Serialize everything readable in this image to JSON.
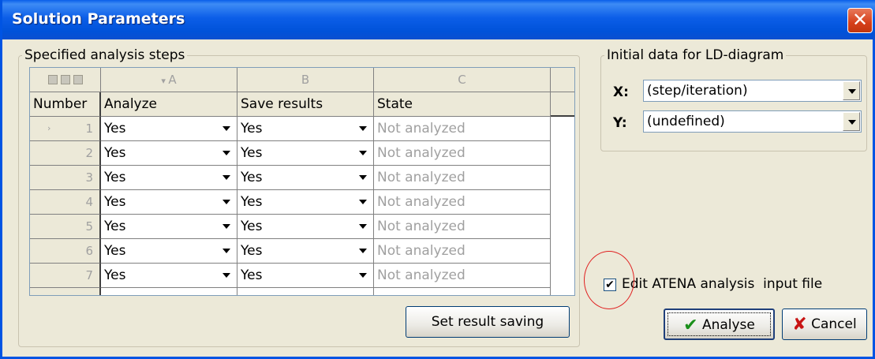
{
  "window": {
    "title": "Solution Parameters",
    "close_glyph": "✕"
  },
  "steps_group": {
    "legend": "Specified analysis steps"
  },
  "grid": {
    "column_letters": [
      "A",
      "B",
      "C"
    ],
    "column_names": [
      "Number",
      "Analyze",
      "Save results",
      "State"
    ],
    "rows": [
      {
        "number": "1",
        "analyze": "Yes",
        "save": "Yes",
        "state": "Not analyzed"
      },
      {
        "number": "2",
        "analyze": "Yes",
        "save": "Yes",
        "state": "Not analyzed"
      },
      {
        "number": "3",
        "analyze": "Yes",
        "save": "Yes",
        "state": "Not analyzed"
      },
      {
        "number": "4",
        "analyze": "Yes",
        "save": "Yes",
        "state": "Not analyzed"
      },
      {
        "number": "5",
        "analyze": "Yes",
        "save": "Yes",
        "state": "Not analyzed"
      },
      {
        "number": "6",
        "analyze": "Yes",
        "save": "Yes",
        "state": "Not analyzed"
      },
      {
        "number": "7",
        "analyze": "Yes",
        "save": "Yes",
        "state": "Not analyzed"
      }
    ]
  },
  "set_result_saving_label": "Set result saving",
  "ld_group": {
    "legend": "Initial data for LD-diagram",
    "x_label": "X:",
    "x_value": "(step/iteration)",
    "y_label": "Y:",
    "y_value": "(undefined)"
  },
  "edit_input": {
    "label": "Edit ATENA analysis  input file",
    "checked": true,
    "check_glyph": "✔"
  },
  "buttons": {
    "analyse": "Analyse",
    "cancel": "Cancel",
    "analyse_icon": "✔",
    "cancel_icon": "✘"
  },
  "colors": {
    "analyse_icon": "#1a8f1a",
    "cancel_icon": "#c81414"
  }
}
